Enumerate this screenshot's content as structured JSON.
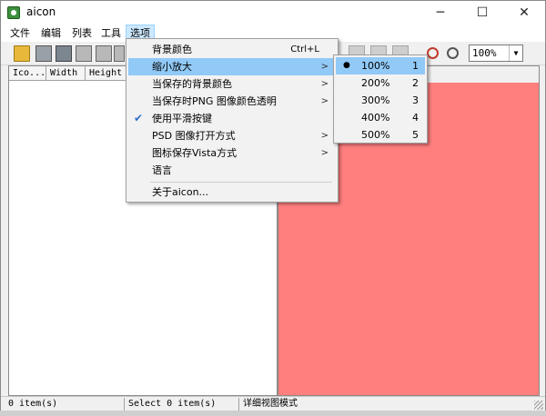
{
  "window": {
    "title": "aicon",
    "min_glyph": "─",
    "max_glyph": "☐",
    "close_glyph": "✕"
  },
  "menubar": {
    "items": [
      "文件",
      "编辑",
      "列表",
      "工具",
      "选项"
    ]
  },
  "toolbar": {
    "zoom_value": "100%",
    "zoom_arrow": "▼"
  },
  "list": {
    "columns": [
      "Ico...",
      "Width",
      "Height"
    ]
  },
  "statusbar": {
    "items": "0 item(s)",
    "selected": "Select 0 item(s)",
    "mode": "详细视图模式"
  },
  "options_menu": {
    "items": [
      {
        "label": "背景颜色",
        "shortcut": "Ctrl+L",
        "submenu": false,
        "checked": false,
        "highlight": false
      },
      {
        "label": "缩小放大",
        "shortcut": "",
        "submenu": true,
        "checked": false,
        "highlight": true
      },
      {
        "label": "当保存的背景颜色",
        "shortcut": "",
        "submenu": true,
        "checked": false,
        "highlight": false
      },
      {
        "label": "当保存时PNG 图像颜色透明",
        "shortcut": "",
        "submenu": true,
        "checked": false,
        "highlight": false
      },
      {
        "label": "使用平滑按键",
        "shortcut": "",
        "submenu": false,
        "checked": true,
        "highlight": false
      },
      {
        "label": "PSD 图像打开方式",
        "shortcut": "",
        "submenu": true,
        "checked": false,
        "highlight": false
      },
      {
        "label": "图标保存Vista方式",
        "shortcut": "",
        "submenu": true,
        "checked": false,
        "highlight": false
      },
      {
        "label": "语言",
        "shortcut": "",
        "submenu": false,
        "checked": false,
        "highlight": false
      },
      {
        "label": "关于aicon...",
        "shortcut": "",
        "submenu": false,
        "checked": false,
        "highlight": false
      }
    ],
    "submenu_arrow": ">",
    "check_glyph": "✔"
  },
  "zoom_menu": {
    "bullet_glyph": "●",
    "items": [
      {
        "label": "100%",
        "key": "1",
        "selected": true,
        "highlight": true
      },
      {
        "label": "200%",
        "key": "2",
        "selected": false,
        "highlight": false
      },
      {
        "label": "300%",
        "key": "3",
        "selected": false,
        "highlight": false
      },
      {
        "label": "400%",
        "key": "4",
        "selected": false,
        "highlight": false
      },
      {
        "label": "500%",
        "key": "5",
        "selected": false,
        "highlight": false
      }
    ]
  },
  "colors": {
    "preview_background": "#ff7e7e",
    "menu_highlight": "#91c9f7"
  }
}
